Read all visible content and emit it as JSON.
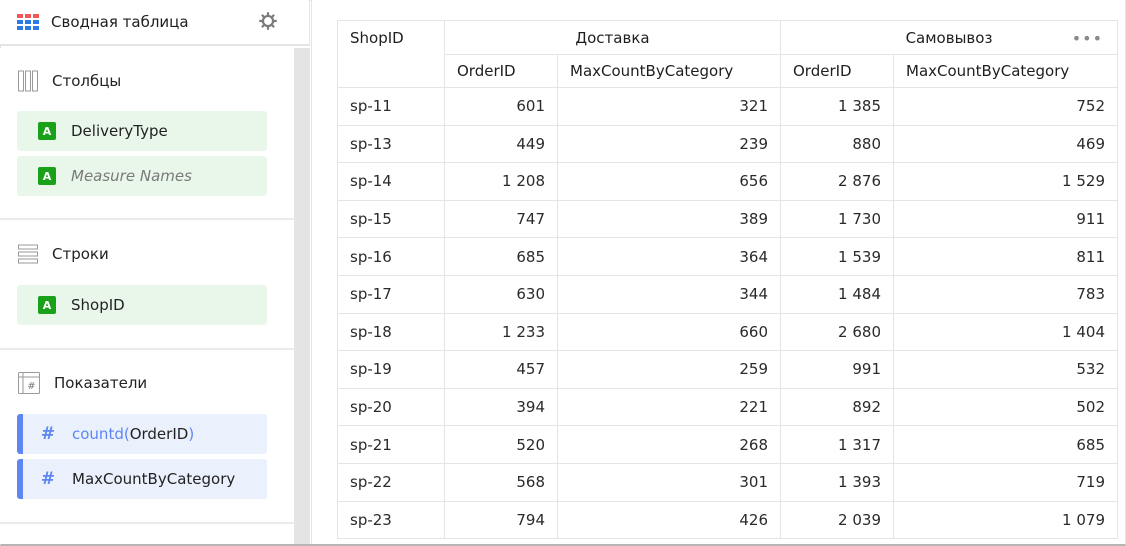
{
  "panel": {
    "title": "Сводная таблица",
    "icons": {
      "visualization": "pivot-table-icon",
      "settings": "gear-icon"
    },
    "sections": {
      "columns": {
        "title": "Столбцы",
        "icon": "columns-icon",
        "items": [
          {
            "type": "A",
            "label": "DeliveryType",
            "italic": false
          },
          {
            "type": "A",
            "label": "Measure Names",
            "italic": true
          }
        ]
      },
      "rows": {
        "title": "Строки",
        "icon": "rows-icon",
        "items": [
          {
            "type": "A",
            "label": "ShopID"
          }
        ]
      },
      "measures": {
        "title": "Показатели",
        "icon": "measures-icon",
        "items": [
          {
            "type": "#",
            "fn": "countd",
            "open": "(",
            "field": "OrderID",
            "close": ")"
          },
          {
            "type": "#",
            "label": "MaxCountByCategory"
          }
        ]
      }
    }
  },
  "table": {
    "row_header": "ShopID",
    "groups": [
      "Доставка",
      "Самовывоз"
    ],
    "measures": [
      "OrderID",
      "MaxCountByCategory",
      "OrderID",
      "MaxCountByCategory"
    ],
    "menu_icon": "more-dots-icon",
    "rows": [
      {
        "shop": "sp-11",
        "values": [
          "601",
          "321",
          "1 385",
          "752"
        ]
      },
      {
        "shop": "sp-13",
        "values": [
          "449",
          "239",
          "880",
          "469"
        ]
      },
      {
        "shop": "sp-14",
        "values": [
          "1 208",
          "656",
          "2 876",
          "1 529"
        ]
      },
      {
        "shop": "sp-15",
        "values": [
          "747",
          "389",
          "1 730",
          "911"
        ]
      },
      {
        "shop": "sp-16",
        "values": [
          "685",
          "364",
          "1 539",
          "811"
        ]
      },
      {
        "shop": "sp-17",
        "values": [
          "630",
          "344",
          "1 484",
          "783"
        ]
      },
      {
        "shop": "sp-18",
        "values": [
          "1 233",
          "660",
          "2 680",
          "1 404"
        ]
      },
      {
        "shop": "sp-19",
        "values": [
          "457",
          "259",
          "991",
          "532"
        ]
      },
      {
        "shop": "sp-20",
        "values": [
          "394",
          "221",
          "892",
          "502"
        ]
      },
      {
        "shop": "sp-21",
        "values": [
          "520",
          "268",
          "1 317",
          "685"
        ]
      },
      {
        "shop": "sp-22",
        "values": [
          "568",
          "301",
          "1 393",
          "719"
        ]
      },
      {
        "shop": "sp-23",
        "values": [
          "794",
          "426",
          "2 039",
          "1 079"
        ]
      }
    ]
  },
  "colors": {
    "dimension_badge": "#1aa11a",
    "dimension_chip_bg": "#e9f7ea",
    "measure_accent": "#5e86f2",
    "measure_chip_bg": "#eaf1fd",
    "icon_red": "#f25656",
    "icon_blue": "#2b7be7"
  }
}
